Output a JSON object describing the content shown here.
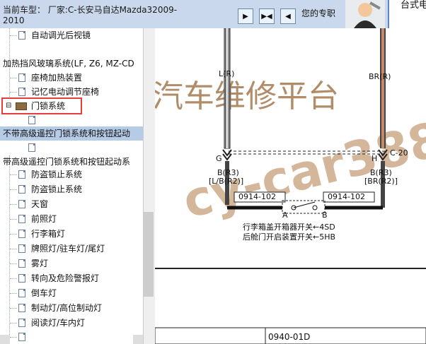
{
  "topbar": {
    "vehicle": "当前车型： 厂家:C-长安马自达Mazda32009-2010",
    "pro_label": "您的专职",
    "brand_text": "台式电"
  },
  "tree": [
    "自动调光后视镜",
    "加热挡风玻璃系统(LF, Z6, MZ-CD",
    "座椅加热装置",
    "记忆电动调节座椅",
    "门锁系统",
    "不带高级遥控门锁系统和按钮起动",
    "带高级遥控门锁系统和按钮起动系",
    "防盗锁止系统",
    "防盗锁止系统",
    "天窗",
    "前照灯",
    "行李箱灯",
    "牌照灯/驻车灯/尾灯",
    "雾灯",
    "转向及危险警报灯",
    "倒车灯",
    "制动灯/高位制动灯",
    "阅读灯/车内灯"
  ],
  "diagram": {
    "L_R": "L(R)",
    "BR_R": "BR(R)",
    "G": "G",
    "H": "H",
    "C20": "C-20",
    "B_R3_left": "B(R3)",
    "LB_R2": "[L/B(R2)]",
    "B_R3_right": "B(R3)",
    "BR_R2": "[BR(R2)]",
    "conn_left": "0914-102",
    "conn_right": "0914-102",
    "A": "A",
    "B": "B",
    "line1": "行李箱盖开箱器开关←4SD",
    "line2": "后舱门开启装置开关←5HB",
    "bottom_code": "0940-01D"
  },
  "watermark": {
    "top": "汽车维修平台",
    "diag": "cy-car388"
  }
}
